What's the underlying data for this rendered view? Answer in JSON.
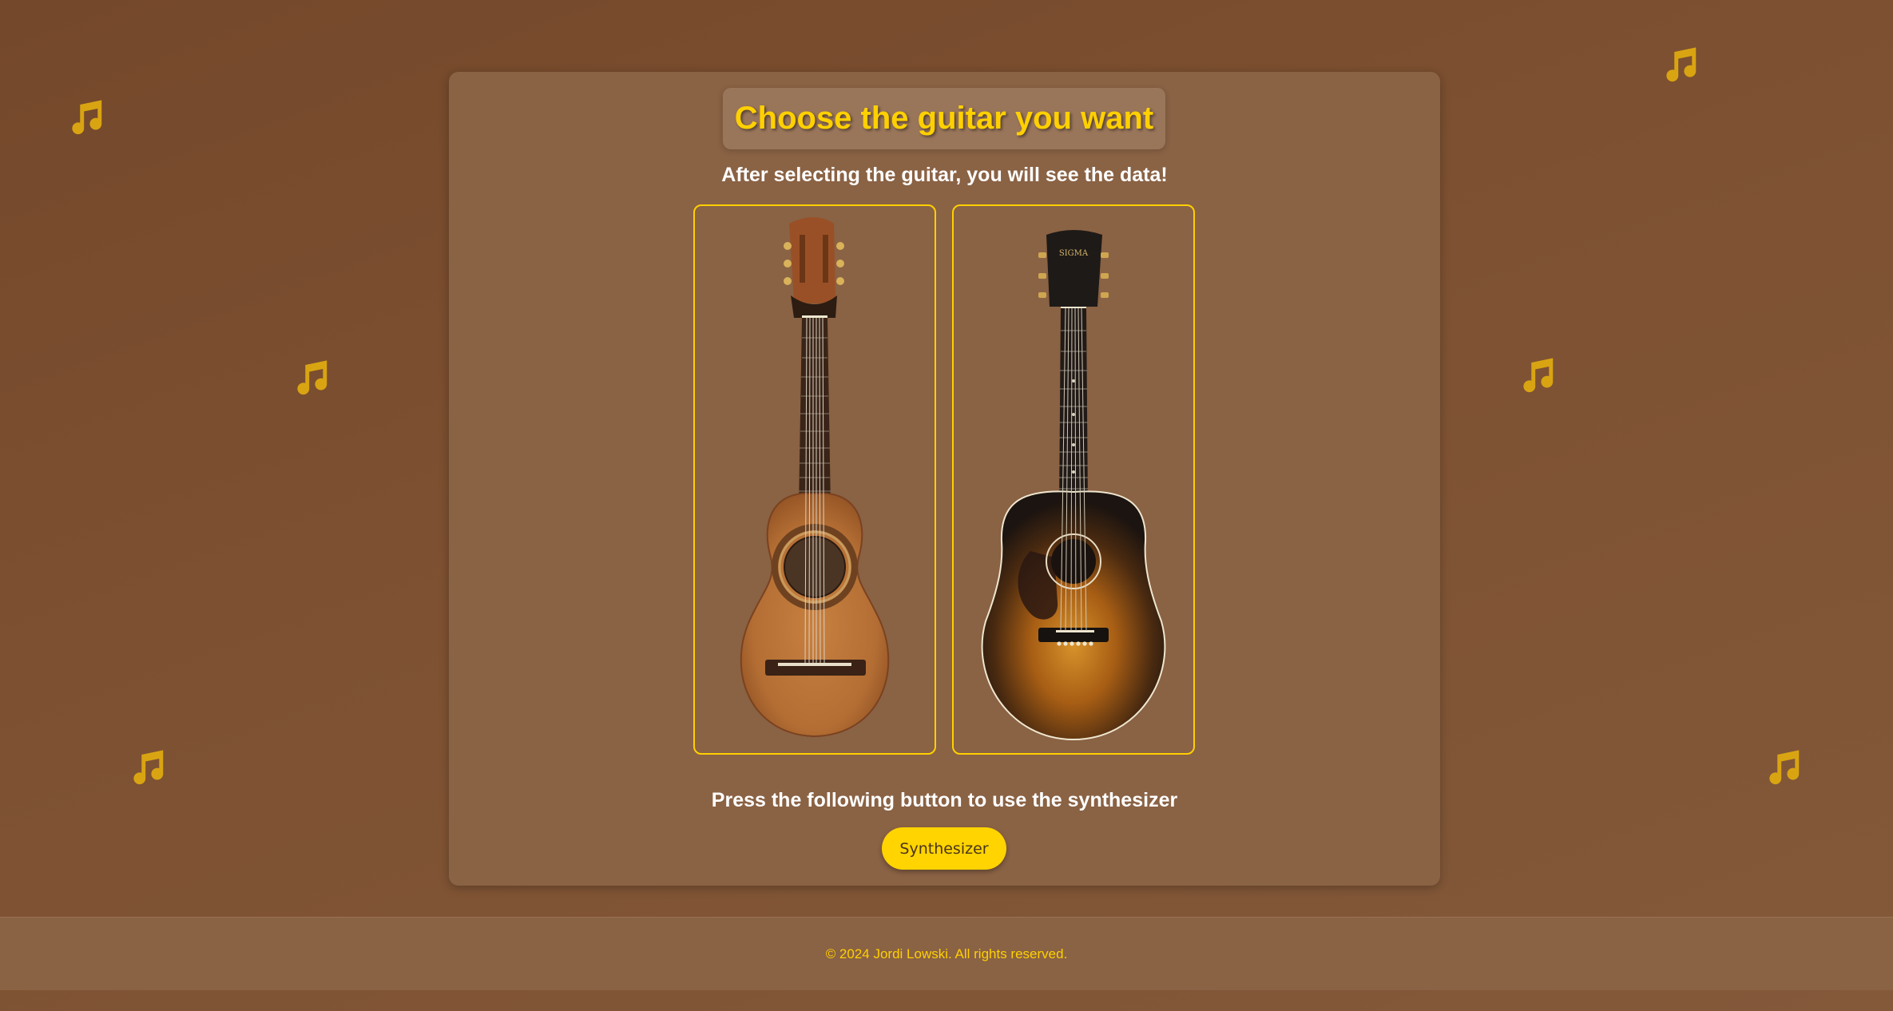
{
  "page": {
    "title": "Choose the guitar you want",
    "subtitle": "After selecting the guitar, you will see the data!",
    "guitars": [
      {
        "name": "classical-guitar-image"
      },
      {
        "name": "acoustic-sunburst-guitar-image"
      }
    ],
    "synth_prompt": "Press the following button to use the synthesizer",
    "synth_button_label": "Synthesizer"
  },
  "footer": {
    "copyright": "© 2024 Jordi Lowski. All rights reserved."
  },
  "decorations": {
    "icon": "music-note-icon",
    "color": "#d9a412"
  },
  "colors": {
    "background": "#7a4e2f",
    "card": "#8a6244",
    "accent": "#ffd000",
    "text": "#ffffff"
  }
}
